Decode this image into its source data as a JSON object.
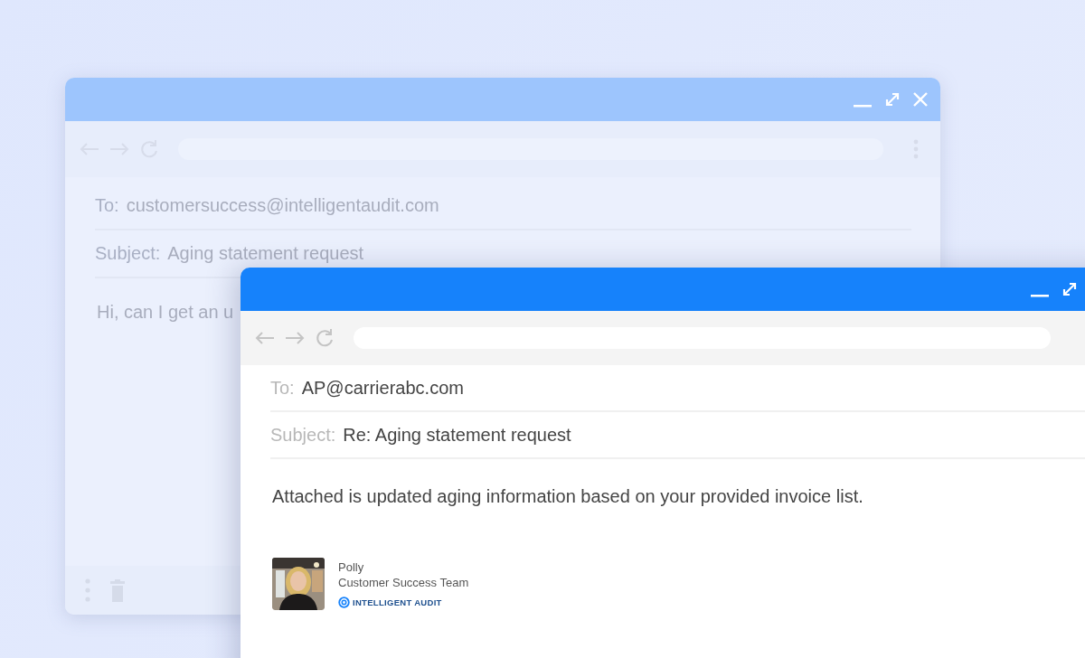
{
  "background_window": {
    "to_label": "To:",
    "to": "customersuccess@intelligentaudit.com",
    "subject_label": "Subject:",
    "subject": "Aging statement request",
    "body": "Hi, can I get an u"
  },
  "front_window": {
    "to_label": "To:",
    "to": "AP@carrierabc.com",
    "subject_label": "Subject:",
    "subject": "Re: Aging statement request",
    "body": "Attached is updated aging information based on your provided invoice list.",
    "signature": {
      "name": "Polly",
      "team": "Customer Success Team",
      "company": "INTELLIGENT AUDIT"
    }
  }
}
